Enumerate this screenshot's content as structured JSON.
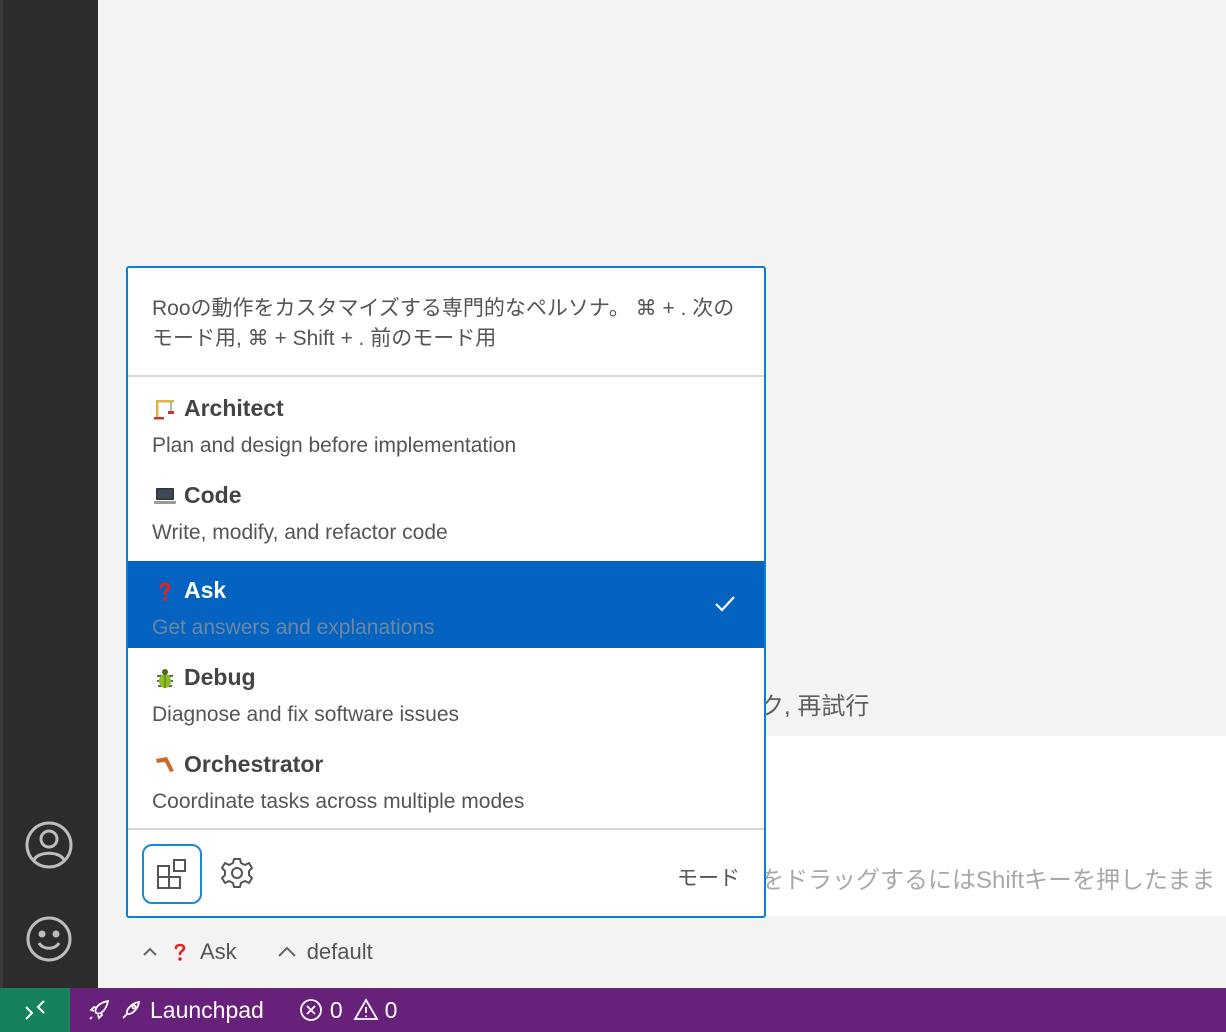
{
  "popup": {
    "description": "Rooの動作をカスタマイズする専門的なペルソナ。 ⌘ + . 次のモード用, ⌘ + Shift + . 前のモード用",
    "modes": [
      {
        "icon": "construction-crane-emoji",
        "name": "Architect",
        "description": "Plan and design before implementation",
        "selected": false
      },
      {
        "icon": "laptop-emoji",
        "name": "Code",
        "description": "Write, modify, and refactor code",
        "selected": false
      },
      {
        "icon": "red-question-mark-emoji",
        "name": "Ask",
        "description": "Get answers and explanations",
        "selected": true
      },
      {
        "icon": "beetle-emoji",
        "name": "Debug",
        "description": "Diagnose and fix software issues",
        "selected": false
      },
      {
        "icon": "boomerang-emoji",
        "name": "Orchestrator",
        "description": "Coordinate tasks across multiple modes",
        "selected": false
      }
    ],
    "footer_label": "モード"
  },
  "background": {
    "hint_text": "ク, 再試行",
    "input_placeholder": "をドラッグするにはShiftキーを押したまま"
  },
  "toolbar": {
    "mode_label": "Ask",
    "profile_label": "default"
  },
  "status_bar": {
    "launchpad_label": "Launchpad",
    "errors": "0",
    "warnings": "0"
  },
  "colors": {
    "accent": "#0463c1",
    "status_bar": "#68217a",
    "remote": "#16825d",
    "popup_border": "#0c7fd4"
  }
}
